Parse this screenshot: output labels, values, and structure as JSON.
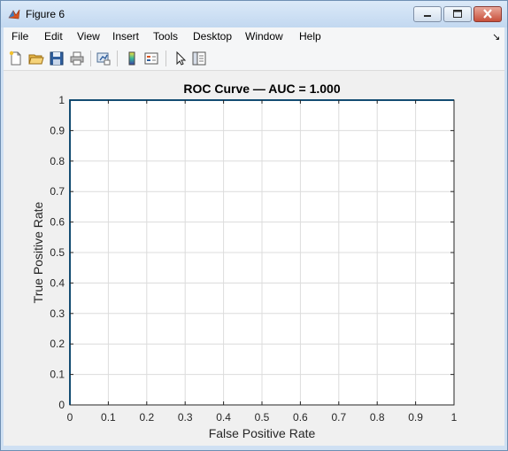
{
  "window": {
    "title": "Figure 6"
  },
  "menu": {
    "items": [
      "File",
      "Edit",
      "View",
      "Insert",
      "Tools",
      "Desktop",
      "Window",
      "Help"
    ]
  },
  "toolbar": {
    "buttons": [
      "new-figure-icon",
      "open-file-icon",
      "save-icon",
      "print-icon",
      "link-plot-icon",
      "colorbar-icon",
      "legend-icon",
      "pointer-icon",
      "property-editor-icon"
    ]
  },
  "colors": {
    "line": "#0072bd",
    "axes_bg": "#ffffff",
    "figure_bg": "#f0f0f0",
    "grid": "#dcdcdc"
  },
  "chart_data": {
    "type": "line",
    "title": "ROC Curve — AUC = 1.000",
    "xlabel": "False Positive Rate",
    "ylabel": "True Positive Rate",
    "xlim": [
      0,
      1
    ],
    "ylim": [
      0,
      1
    ],
    "xticks": [
      "0",
      "0.1",
      "0.2",
      "0.3",
      "0.4",
      "0.5",
      "0.6",
      "0.7",
      "0.8",
      "0.9",
      "1"
    ],
    "yticks": [
      "0",
      "0.1",
      "0.2",
      "0.3",
      "0.4",
      "0.5",
      "0.6",
      "0.7",
      "0.8",
      "0.9",
      "1"
    ],
    "grid": true,
    "series": [
      {
        "x": [
          0,
          0,
          1
        ],
        "y": [
          0,
          1,
          1
        ]
      }
    ]
  }
}
